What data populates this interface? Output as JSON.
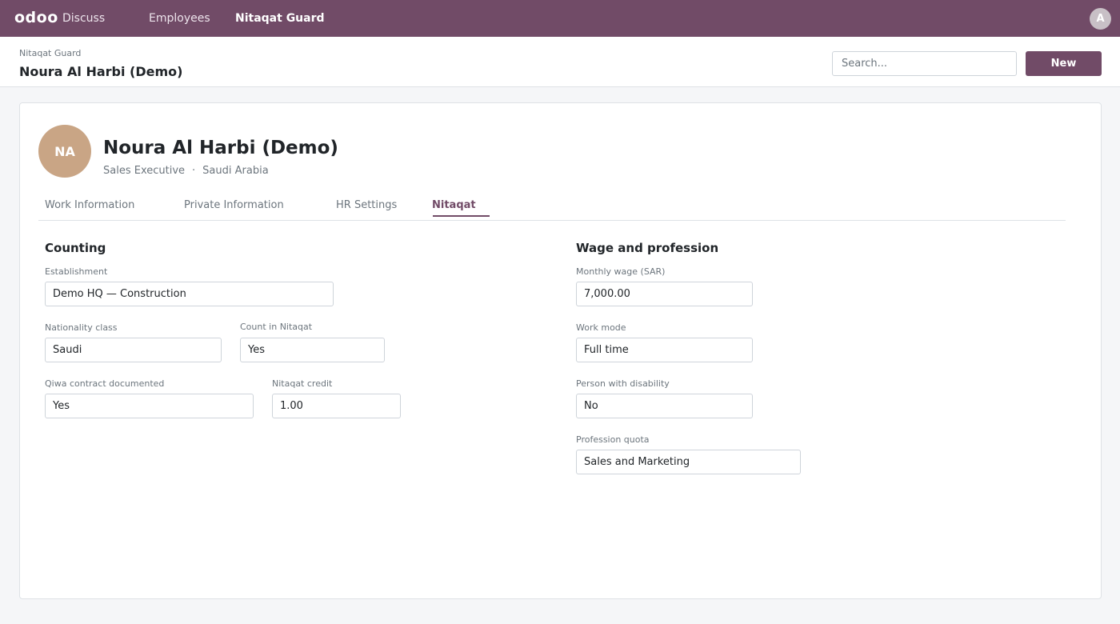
{
  "navbar": {
    "brand": "odoo",
    "items": [
      {
        "label": "Discuss"
      },
      {
        "label": "Employees"
      },
      {
        "label": "Nitaqat Guard",
        "active": true
      }
    ],
    "user_initial": "A",
    "color": "#714b67"
  },
  "control": {
    "breadcrumb_parent": "Nitaqat Guard",
    "breadcrumb_current": "Noura Al Harbi (Demo)",
    "search_placeholder": "Search...",
    "new_label": "New"
  },
  "employee": {
    "initials": "NA",
    "name": "Noura Al Harbi (Demo)",
    "job_title": "Sales Executive",
    "separator": "·",
    "country": "Saudi Arabia",
    "avatar_color": "#c9a585"
  },
  "tabs": [
    {
      "label": "Work Information"
    },
    {
      "label": "Private Information"
    },
    {
      "label": "HR Settings"
    },
    {
      "label": "Nitaqat",
      "active": true
    }
  ],
  "counting": {
    "title": "Counting",
    "establishment": {
      "label": "Establishment",
      "value": "Demo HQ — Construction"
    },
    "nationality_class": {
      "label": "Nationality class",
      "value": "Saudi"
    },
    "count_in_nitaqat": {
      "label": "Count in Nitaqat",
      "value": "Yes"
    },
    "qiwa_contract": {
      "label": "Qiwa contract documented",
      "value": "Yes"
    },
    "nitaqat_credit": {
      "label": "Nitaqat credit",
      "value": "1.00"
    }
  },
  "wage": {
    "title": "Wage and profession",
    "monthly_wage": {
      "label": "Monthly wage (SAR)",
      "value": "7,000.00"
    },
    "work_mode": {
      "label": "Work mode",
      "value": "Full time"
    },
    "disability": {
      "label": "Person with disability",
      "value": "No"
    },
    "profession_quota": {
      "label": "Profession quota",
      "value": "Sales and Marketing"
    }
  }
}
